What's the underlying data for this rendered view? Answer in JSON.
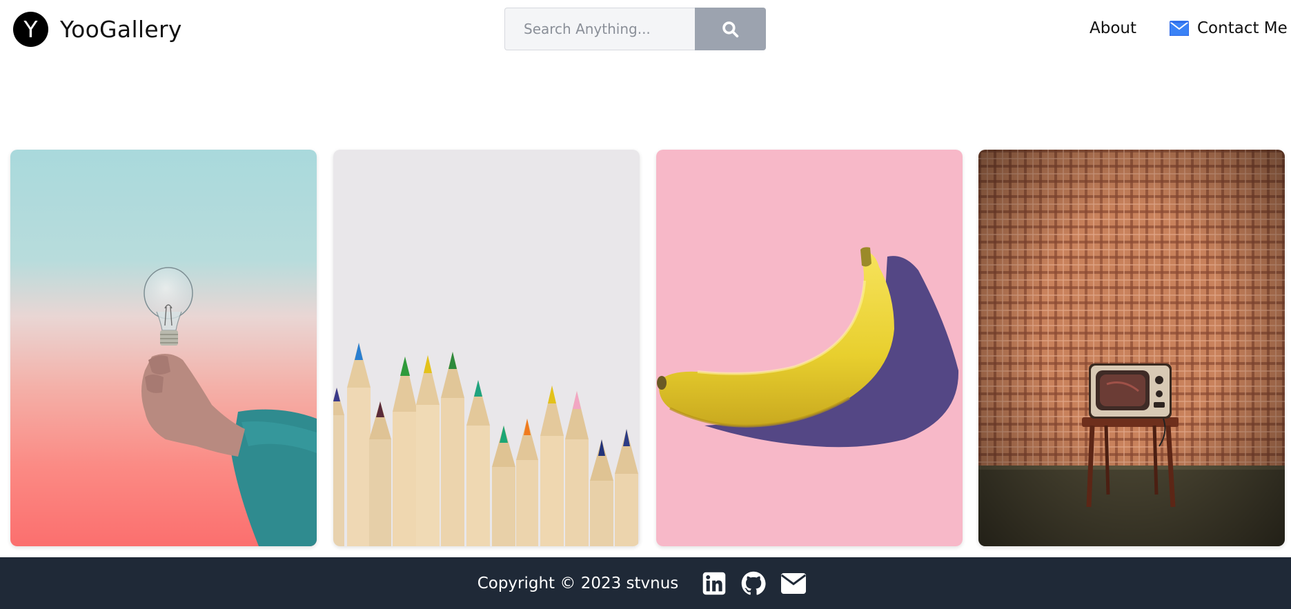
{
  "header": {
    "logo_letter": "Y",
    "brand_name": "YooGallery",
    "search": {
      "placeholder": "Search Anything...",
      "value": "",
      "button_icon": "search-icon"
    },
    "nav": {
      "about_label": "About",
      "contact_label": "Contact Me",
      "contact_icon": "mail-icon"
    }
  },
  "gallery": {
    "photos": [
      {
        "subject": "hand holding a light bulb",
        "icon": "photo"
      },
      {
        "subject": "colored pencils",
        "icon": "photo"
      },
      {
        "subject": "banana on pink background",
        "icon": "photo"
      },
      {
        "subject": "vintage television on stool",
        "icon": "photo"
      }
    ]
  },
  "footer": {
    "copyright": "Copyright © 2023 stvnus",
    "social_icons": [
      "linkedin-icon",
      "github-icon",
      "email-icon"
    ]
  },
  "colors": {
    "footer_bg": "#1f2937",
    "search_button": "#9ca3af",
    "contact_icon": "#3b82f6",
    "logo_bg": "#000000"
  }
}
